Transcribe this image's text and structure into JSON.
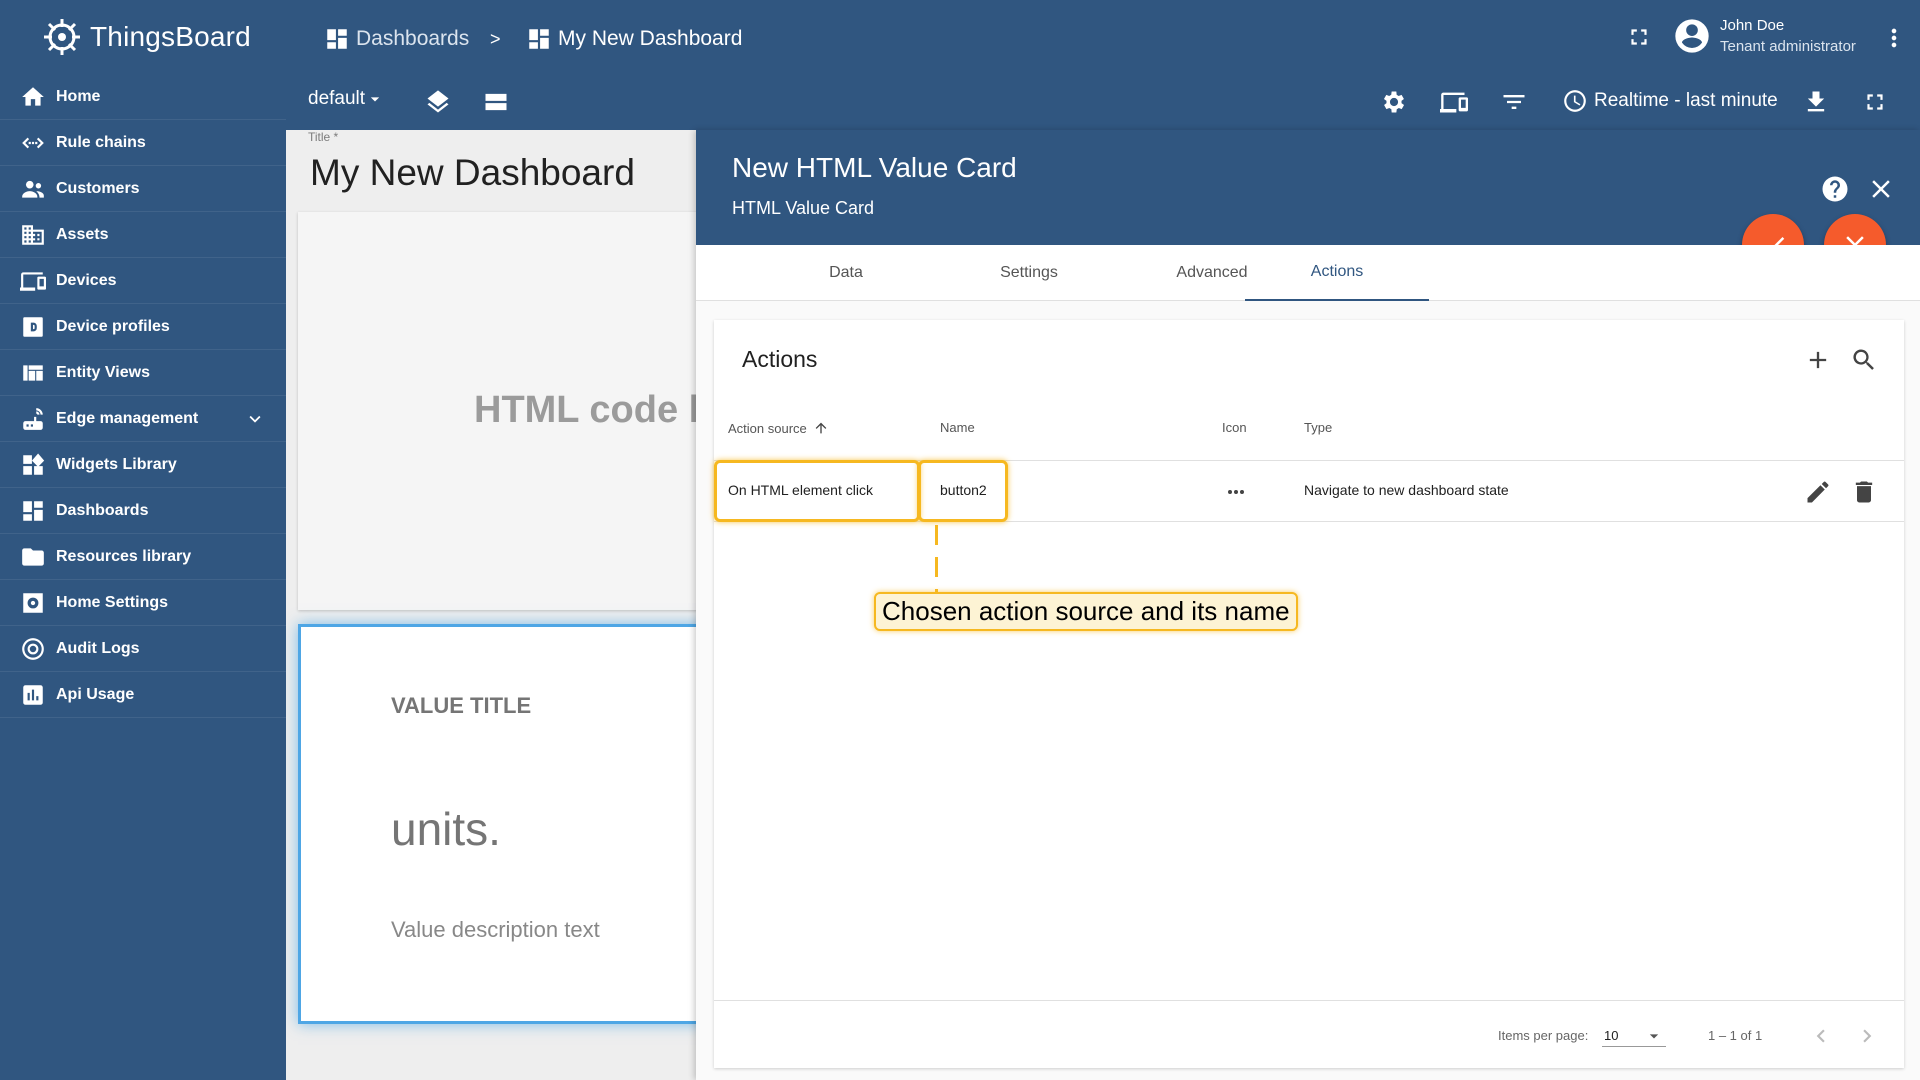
{
  "app": {
    "name": "ThingsBoard"
  },
  "sidebar": {
    "items": [
      {
        "label": "Home",
        "icon": "home-icon"
      },
      {
        "label": "Rule chains",
        "icon": "rule-chain-icon"
      },
      {
        "label": "Customers",
        "icon": "customers-icon"
      },
      {
        "label": "Assets",
        "icon": "assets-icon"
      },
      {
        "label": "Devices",
        "icon": "devices-icon"
      },
      {
        "label": "Device profiles",
        "icon": "device-profile-icon"
      },
      {
        "label": "Entity Views",
        "icon": "entity-views-icon"
      },
      {
        "label": "Edge management",
        "icon": "edge-icon"
      },
      {
        "label": "Widgets Library",
        "icon": "widgets-icon"
      },
      {
        "label": "Dashboards",
        "icon": "dashboards-icon"
      },
      {
        "label": "Resources library",
        "icon": "folder-icon"
      },
      {
        "label": "Home Settings",
        "icon": "settings-icon"
      },
      {
        "label": "Audit Logs",
        "icon": "audit-icon"
      },
      {
        "label": "Api Usage",
        "icon": "api-usage-icon"
      }
    ]
  },
  "header": {
    "breadcrumb": [
      "Dashboards",
      ">",
      "My New Dashboard"
    ],
    "user": {
      "name": "John Doe",
      "role": "Tenant administrator"
    },
    "state": "default",
    "timewindow": "Realtime - last minute"
  },
  "dashboard": {
    "title_label": "Title *",
    "title": "My New Dashboard",
    "widget1_text": "HTML code h",
    "widget2": {
      "value_title": "VALUE TITLE",
      "units": "units.",
      "description": "Value description text"
    }
  },
  "panel": {
    "title": "New HTML Value Card",
    "subtitle": "HTML Value Card",
    "tabs": [
      "Data",
      "Settings",
      "Advanced",
      "Actions"
    ],
    "active_tab": "Actions",
    "colors": {
      "header": "#305680",
      "fab": "#f55b2c",
      "highlight": "#f6b820"
    },
    "actions": {
      "title": "Actions",
      "columns": {
        "source": "Action source",
        "name": "Name",
        "icon": "Icon",
        "type": "Type"
      },
      "rows": [
        {
          "source": "On HTML element click",
          "name": "button2",
          "icon": "more-horiz-icon",
          "type": "Navigate to new dashboard state"
        }
      ],
      "callout": "Chosen action source and its name",
      "footer": {
        "items_per_page_label": "Items per page:",
        "items_per_page": "10",
        "range": "1 – 1 of 1"
      }
    }
  }
}
